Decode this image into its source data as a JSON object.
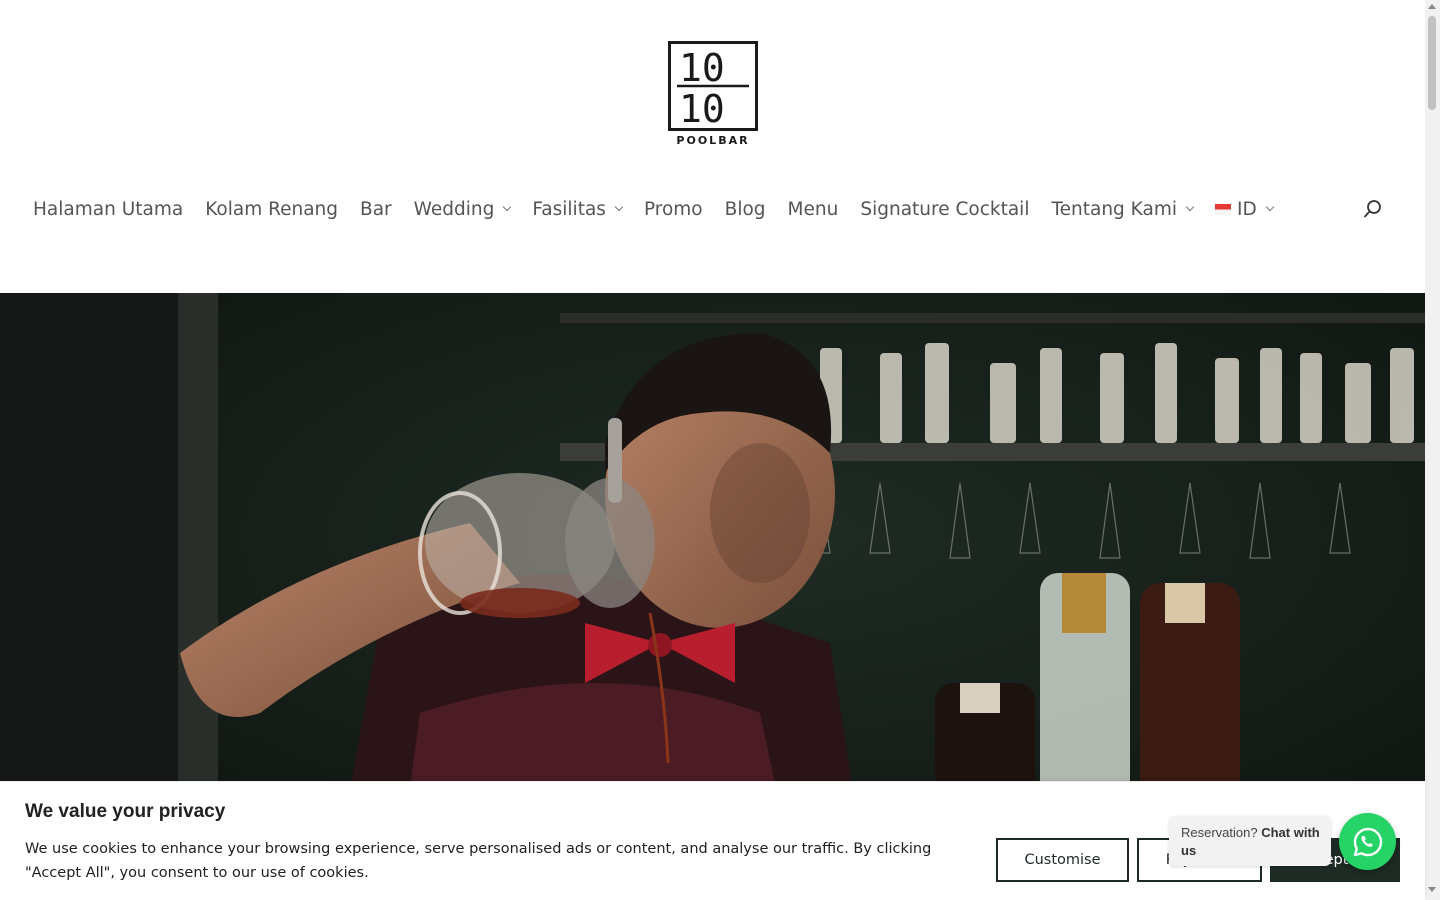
{
  "brand": {
    "logo_text": "POOLBAR",
    "logo_num_top": "10",
    "logo_num_bottom": "10"
  },
  "nav": {
    "items": [
      {
        "label": "Halaman Utama",
        "has_dropdown": false
      },
      {
        "label": "Kolam Renang",
        "has_dropdown": false
      },
      {
        "label": "Bar",
        "has_dropdown": false
      },
      {
        "label": "Wedding",
        "has_dropdown": true
      },
      {
        "label": "Fasilitas",
        "has_dropdown": true
      },
      {
        "label": "Promo",
        "has_dropdown": false
      },
      {
        "label": "Blog",
        "has_dropdown": false
      },
      {
        "label": "Menu",
        "has_dropdown": false
      },
      {
        "label": "Signature Cocktail",
        "has_dropdown": false
      },
      {
        "label": "Tentang Kami",
        "has_dropdown": true
      }
    ],
    "language": {
      "label": "ID",
      "flag": "indonesia-flag-icon"
    },
    "search_icon": "search-icon"
  },
  "cookie": {
    "title": "We value your privacy",
    "text": "We use cookies to enhance your browsing experience, serve personalised ads or content, and analyse our traffic. By clicking \"Accept All\", you consent to our use of cookies.",
    "customise_label": "Customise",
    "reject_label": "Reject All",
    "accept_label": "Accept All",
    "colors": {
      "primary": "#1d2b24"
    }
  },
  "whatsapp": {
    "prompt": "Reservation?",
    "cta": "Chat with us",
    "icon": "whatsapp-icon",
    "color": "#25d366"
  }
}
